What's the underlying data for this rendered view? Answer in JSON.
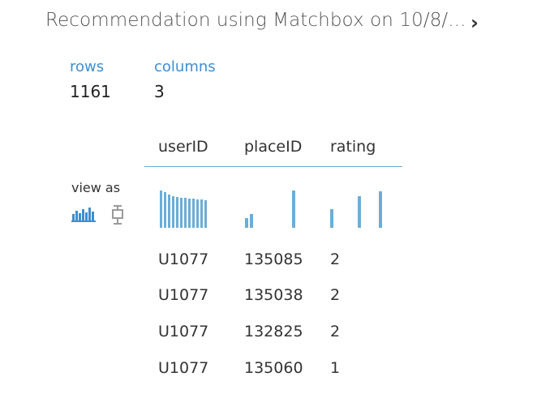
{
  "header": {
    "title": "Recommendation using Matchbox on 10/8/...",
    "next_icon": "chevron-right-icon"
  },
  "stats": {
    "rows_label": "rows",
    "rows_value": "1161",
    "columns_label": "columns",
    "columns_value": "3"
  },
  "view_as": {
    "label": "view as",
    "histogram_icon": "histogram-icon",
    "boxplot_icon": "boxplot-icon"
  },
  "table": {
    "columns": [
      "userID",
      "placeID",
      "rating"
    ],
    "rows": [
      [
        "U1077",
        "135085",
        "2"
      ],
      [
        "U1077",
        "135038",
        "2"
      ],
      [
        "U1077",
        "132825",
        "2"
      ],
      [
        "U1077",
        "135060",
        "1"
      ]
    ]
  },
  "colors": {
    "accent": "#3e8fd0",
    "bar": "#6aaed8"
  }
}
